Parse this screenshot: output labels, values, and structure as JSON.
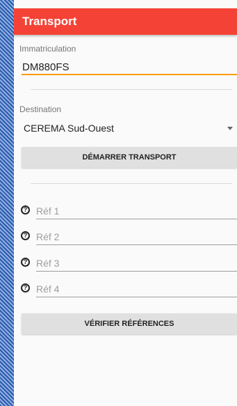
{
  "appbar": {
    "title": "Transport"
  },
  "immatriculation": {
    "label": "Immatriculation",
    "value": "DM880FS"
  },
  "destination": {
    "label": "Destination",
    "selected": "CEREMA Sud-Ouest"
  },
  "start_button": {
    "label": "DÉMARRER TRANSPORT"
  },
  "references": [
    {
      "placeholder": "Réf 1",
      "icon": "help-icon"
    },
    {
      "placeholder": "Réf 2",
      "icon": "help-icon"
    },
    {
      "placeholder": "Réf 3",
      "icon": "help-icon"
    },
    {
      "placeholder": "Réf 4",
      "icon": "help-icon"
    }
  ],
  "verify_button": {
    "label": "VÉRIFIER RÉFÉRENCES"
  },
  "colors": {
    "appbar": "#f44336",
    "accent": "#ff9800",
    "background": "#fafafa"
  }
}
